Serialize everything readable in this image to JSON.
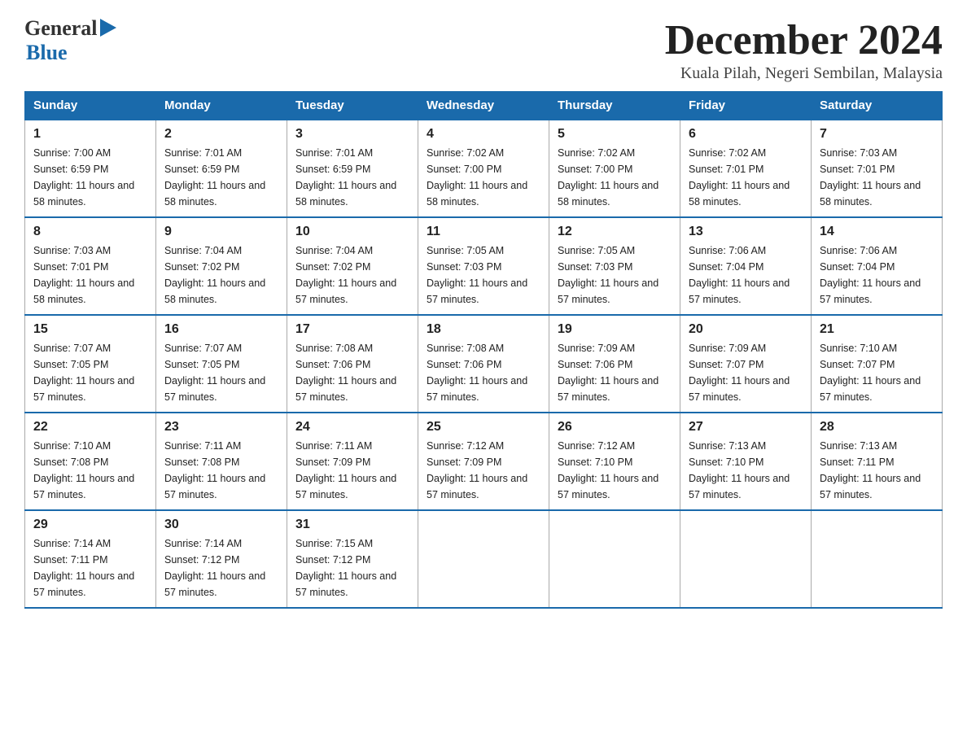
{
  "header": {
    "logo_general": "General",
    "logo_blue": "Blue",
    "title": "December 2024",
    "subtitle": "Kuala Pilah, Negeri Sembilan, Malaysia"
  },
  "days_of_week": [
    "Sunday",
    "Monday",
    "Tuesday",
    "Wednesday",
    "Thursday",
    "Friday",
    "Saturday"
  ],
  "weeks": [
    [
      {
        "day": "1",
        "sunrise": "7:00 AM",
        "sunset": "6:59 PM",
        "daylight": "11 hours and 58 minutes."
      },
      {
        "day": "2",
        "sunrise": "7:01 AM",
        "sunset": "6:59 PM",
        "daylight": "11 hours and 58 minutes."
      },
      {
        "day": "3",
        "sunrise": "7:01 AM",
        "sunset": "6:59 PM",
        "daylight": "11 hours and 58 minutes."
      },
      {
        "day": "4",
        "sunrise": "7:02 AM",
        "sunset": "7:00 PM",
        "daylight": "11 hours and 58 minutes."
      },
      {
        "day": "5",
        "sunrise": "7:02 AM",
        "sunset": "7:00 PM",
        "daylight": "11 hours and 58 minutes."
      },
      {
        "day": "6",
        "sunrise": "7:02 AM",
        "sunset": "7:01 PM",
        "daylight": "11 hours and 58 minutes."
      },
      {
        "day": "7",
        "sunrise": "7:03 AM",
        "sunset": "7:01 PM",
        "daylight": "11 hours and 58 minutes."
      }
    ],
    [
      {
        "day": "8",
        "sunrise": "7:03 AM",
        "sunset": "7:01 PM",
        "daylight": "11 hours and 58 minutes."
      },
      {
        "day": "9",
        "sunrise": "7:04 AM",
        "sunset": "7:02 PM",
        "daylight": "11 hours and 58 minutes."
      },
      {
        "day": "10",
        "sunrise": "7:04 AM",
        "sunset": "7:02 PM",
        "daylight": "11 hours and 57 minutes."
      },
      {
        "day": "11",
        "sunrise": "7:05 AM",
        "sunset": "7:03 PM",
        "daylight": "11 hours and 57 minutes."
      },
      {
        "day": "12",
        "sunrise": "7:05 AM",
        "sunset": "7:03 PM",
        "daylight": "11 hours and 57 minutes."
      },
      {
        "day": "13",
        "sunrise": "7:06 AM",
        "sunset": "7:04 PM",
        "daylight": "11 hours and 57 minutes."
      },
      {
        "day": "14",
        "sunrise": "7:06 AM",
        "sunset": "7:04 PM",
        "daylight": "11 hours and 57 minutes."
      }
    ],
    [
      {
        "day": "15",
        "sunrise": "7:07 AM",
        "sunset": "7:05 PM",
        "daylight": "11 hours and 57 minutes."
      },
      {
        "day": "16",
        "sunrise": "7:07 AM",
        "sunset": "7:05 PM",
        "daylight": "11 hours and 57 minutes."
      },
      {
        "day": "17",
        "sunrise": "7:08 AM",
        "sunset": "7:06 PM",
        "daylight": "11 hours and 57 minutes."
      },
      {
        "day": "18",
        "sunrise": "7:08 AM",
        "sunset": "7:06 PM",
        "daylight": "11 hours and 57 minutes."
      },
      {
        "day": "19",
        "sunrise": "7:09 AM",
        "sunset": "7:06 PM",
        "daylight": "11 hours and 57 minutes."
      },
      {
        "day": "20",
        "sunrise": "7:09 AM",
        "sunset": "7:07 PM",
        "daylight": "11 hours and 57 minutes."
      },
      {
        "day": "21",
        "sunrise": "7:10 AM",
        "sunset": "7:07 PM",
        "daylight": "11 hours and 57 minutes."
      }
    ],
    [
      {
        "day": "22",
        "sunrise": "7:10 AM",
        "sunset": "7:08 PM",
        "daylight": "11 hours and 57 minutes."
      },
      {
        "day": "23",
        "sunrise": "7:11 AM",
        "sunset": "7:08 PM",
        "daylight": "11 hours and 57 minutes."
      },
      {
        "day": "24",
        "sunrise": "7:11 AM",
        "sunset": "7:09 PM",
        "daylight": "11 hours and 57 minutes."
      },
      {
        "day": "25",
        "sunrise": "7:12 AM",
        "sunset": "7:09 PM",
        "daylight": "11 hours and 57 minutes."
      },
      {
        "day": "26",
        "sunrise": "7:12 AM",
        "sunset": "7:10 PM",
        "daylight": "11 hours and 57 minutes."
      },
      {
        "day": "27",
        "sunrise": "7:13 AM",
        "sunset": "7:10 PM",
        "daylight": "11 hours and 57 minutes."
      },
      {
        "day": "28",
        "sunrise": "7:13 AM",
        "sunset": "7:11 PM",
        "daylight": "11 hours and 57 minutes."
      }
    ],
    [
      {
        "day": "29",
        "sunrise": "7:14 AM",
        "sunset": "7:11 PM",
        "daylight": "11 hours and 57 minutes."
      },
      {
        "day": "30",
        "sunrise": "7:14 AM",
        "sunset": "7:12 PM",
        "daylight": "11 hours and 57 minutes."
      },
      {
        "day": "31",
        "sunrise": "7:15 AM",
        "sunset": "7:12 PM",
        "daylight": "11 hours and 57 minutes."
      },
      null,
      null,
      null,
      null
    ]
  ]
}
